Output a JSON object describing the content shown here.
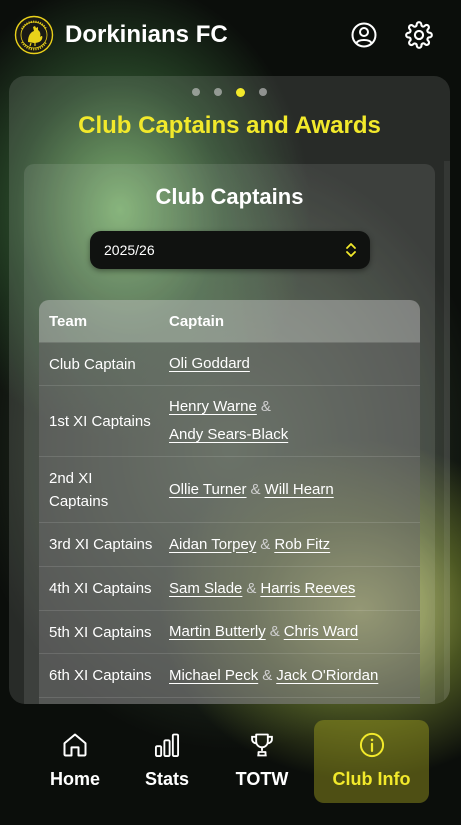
{
  "app": {
    "title": "Dorkinians FC",
    "logo_text": "DORKINIANS FOOTBALL CLUB"
  },
  "header": {
    "icons": [
      "user-circle-icon",
      "gear-icon"
    ]
  },
  "carousel": {
    "dots": 4,
    "active_index": 2
  },
  "page": {
    "title": "Club Captains and Awards"
  },
  "section": {
    "title": "Club Captains",
    "season": {
      "value": "2025/26"
    }
  },
  "table": {
    "headers": {
      "team": "Team",
      "captain": "Captain"
    },
    "rows": [
      {
        "team": "Club Captain",
        "captains": [
          "Oli Goddard"
        ]
      },
      {
        "team": "1st XI Captains",
        "captains": [
          "Henry Warne",
          "Andy Sears-Black"
        ]
      },
      {
        "team": "2nd XI Captains",
        "captains": [
          "Ollie Turner",
          "Will Hearn"
        ]
      },
      {
        "team": "3rd XI Captains",
        "captains": [
          "Aidan Torpey",
          "Rob Fitz"
        ]
      },
      {
        "team": "4th XI Captains",
        "captains": [
          "Sam Slade",
          "Harris Reeves"
        ]
      },
      {
        "team": "5th XI Captains",
        "captains": [
          "Martin Butterly",
          "Chris Ward"
        ]
      },
      {
        "team": "6th XI Captains",
        "captains": [
          "Michael Peck",
          "Jack O'Riordan"
        ]
      }
    ],
    "separator": "&"
  },
  "nav": {
    "items": [
      {
        "label": "Home",
        "icon": "home-icon"
      },
      {
        "label": "Stats",
        "icon": "bar-chart-icon"
      },
      {
        "label": "TOTW",
        "icon": "trophy-icon"
      },
      {
        "label": "Club Info",
        "icon": "info-icon"
      }
    ],
    "active": "Club Info"
  },
  "colors": {
    "accent": "#f2e92b",
    "background": "#0b0e0b"
  }
}
